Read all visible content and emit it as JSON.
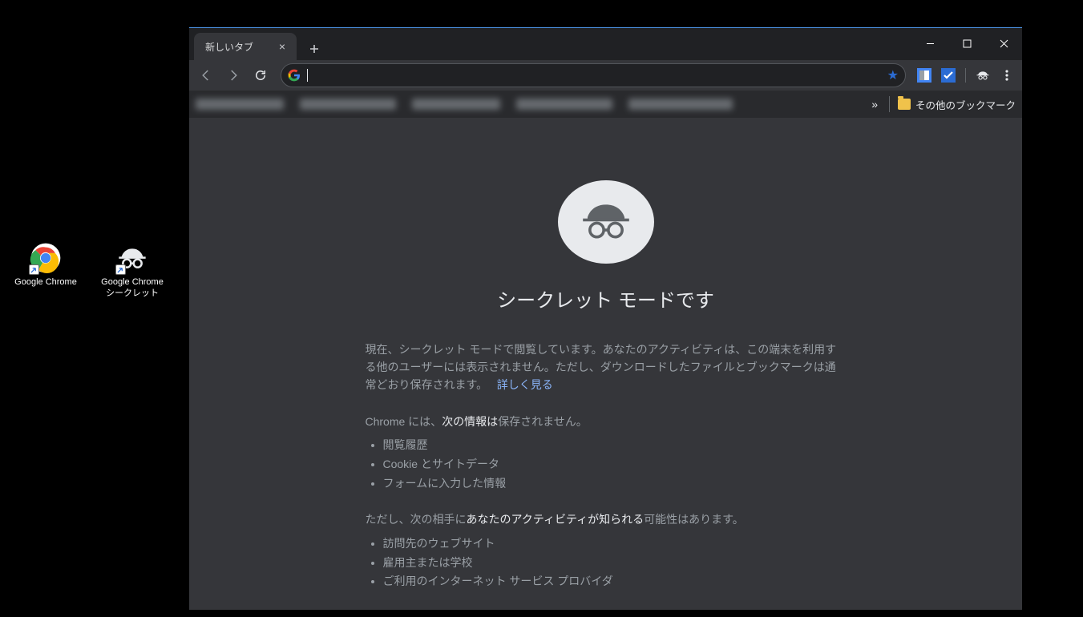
{
  "desktop": {
    "items": [
      {
        "label": "Google Chrome"
      },
      {
        "label": "Google Chrome\nシークレット"
      }
    ]
  },
  "window": {
    "tab": {
      "title": "新しいタブ"
    },
    "bookmarks": {
      "other": "その他のブックマーク",
      "overflow": "»"
    },
    "incognito": {
      "heading": "シークレット モードです",
      "intro_a": "現在、シークレット モードで閲覧しています。あなたのアクティビティは、この端末を利用する他のユーザーには表示されません。ただし、ダウンロードしたファイルとブックマークは通常どおり保存されます。",
      "learn_more": "詳しく見る",
      "not_saved_lead_a": "Chrome には、",
      "not_saved_lead_b": "次の情報は",
      "not_saved_lead_c": "保存されません。",
      "not_saved": [
        "閲覧履歴",
        "Cookie とサイトデータ",
        "フォームに入力した情報"
      ],
      "visible_lead_a": "ただし、次の相手に",
      "visible_lead_b": "あなたのアクティビティが知られる",
      "visible_lead_c": "可能性はあります。",
      "visible_to": [
        "訪問先のウェブサイト",
        "雇用主または学校",
        "ご利用のインターネット サービス プロバイダ"
      ]
    }
  }
}
